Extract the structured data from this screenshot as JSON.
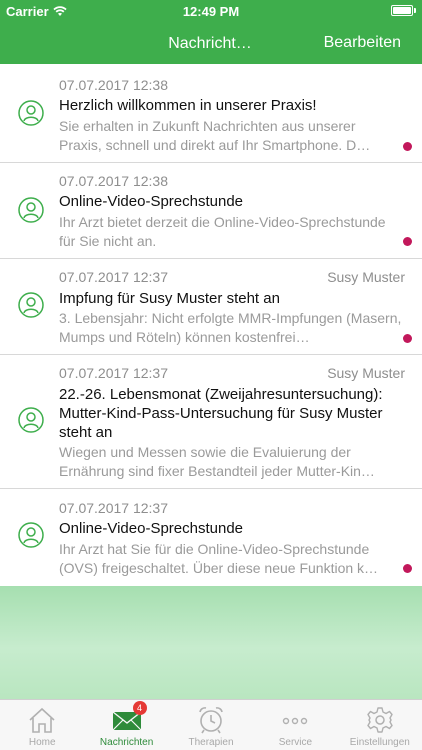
{
  "status_bar": {
    "carrier": "Carrier",
    "time": "12:49 PM"
  },
  "nav": {
    "title": "Nachricht…",
    "edit_label": "Bearbeiten"
  },
  "messages": [
    {
      "date": "07.07.2017 12:38",
      "sender": "",
      "title": "Herzlich willkommen in unserer Praxis!",
      "body": "Sie erhalten in Zukunft Nachrichten aus unserer Praxis, schnell und direkt auf Ihr Smartphone. D…",
      "unread": true
    },
    {
      "date": "07.07.2017 12:38",
      "sender": "",
      "title": "Online-Video-Sprechstunde",
      "body": "Ihr Arzt bietet derzeit die Online-Video-Sprechstunde für Sie nicht an.",
      "unread": true
    },
    {
      "date": "07.07.2017 12:37",
      "sender": "Susy Muster",
      "title": "Impfung für Susy Muster steht an",
      "body": "3. Lebensjahr: Nicht erfolgte MMR-Impfungen (Masern, Mumps und Röteln) können kostenfrei…",
      "unread": true
    },
    {
      "date": "07.07.2017 12:37",
      "sender": "Susy Muster",
      "title": "22.-26. Lebensmonat  (Zweijahresuntersuchung): Mutter-Kind-Pass-Untersuchung für Susy Muster steht an",
      "body": "Wiegen und Messen sowie die Evaluierung der Ernährung sind fixer Bestandteil jeder Mutter-Kin…",
      "unread": false
    },
    {
      "date": "07.07.2017 12:37",
      "sender": "",
      "title": "Online-Video-Sprechstunde",
      "body": "Ihr Arzt hat Sie für die Online-Video-Sprechstunde (OVS) freigeschaltet. Über diese neue Funktion k…",
      "unread": true
    }
  ],
  "tabs": [
    {
      "label": "Home",
      "icon": "house-icon",
      "active": false
    },
    {
      "label": "Nachrichten",
      "icon": "envelope-icon",
      "active": true,
      "badge": "4"
    },
    {
      "label": "Therapien",
      "icon": "alarm-clock-icon",
      "active": false
    },
    {
      "label": "Service",
      "icon": "dots-icon",
      "active": false
    },
    {
      "label": "Einstellungen",
      "icon": "gear-icon",
      "active": false
    }
  ],
  "colors": {
    "header": "#3eae4c",
    "unread_dot": "#c2185b",
    "active_tab": "#2e8b3a",
    "badge": "#e53935"
  }
}
